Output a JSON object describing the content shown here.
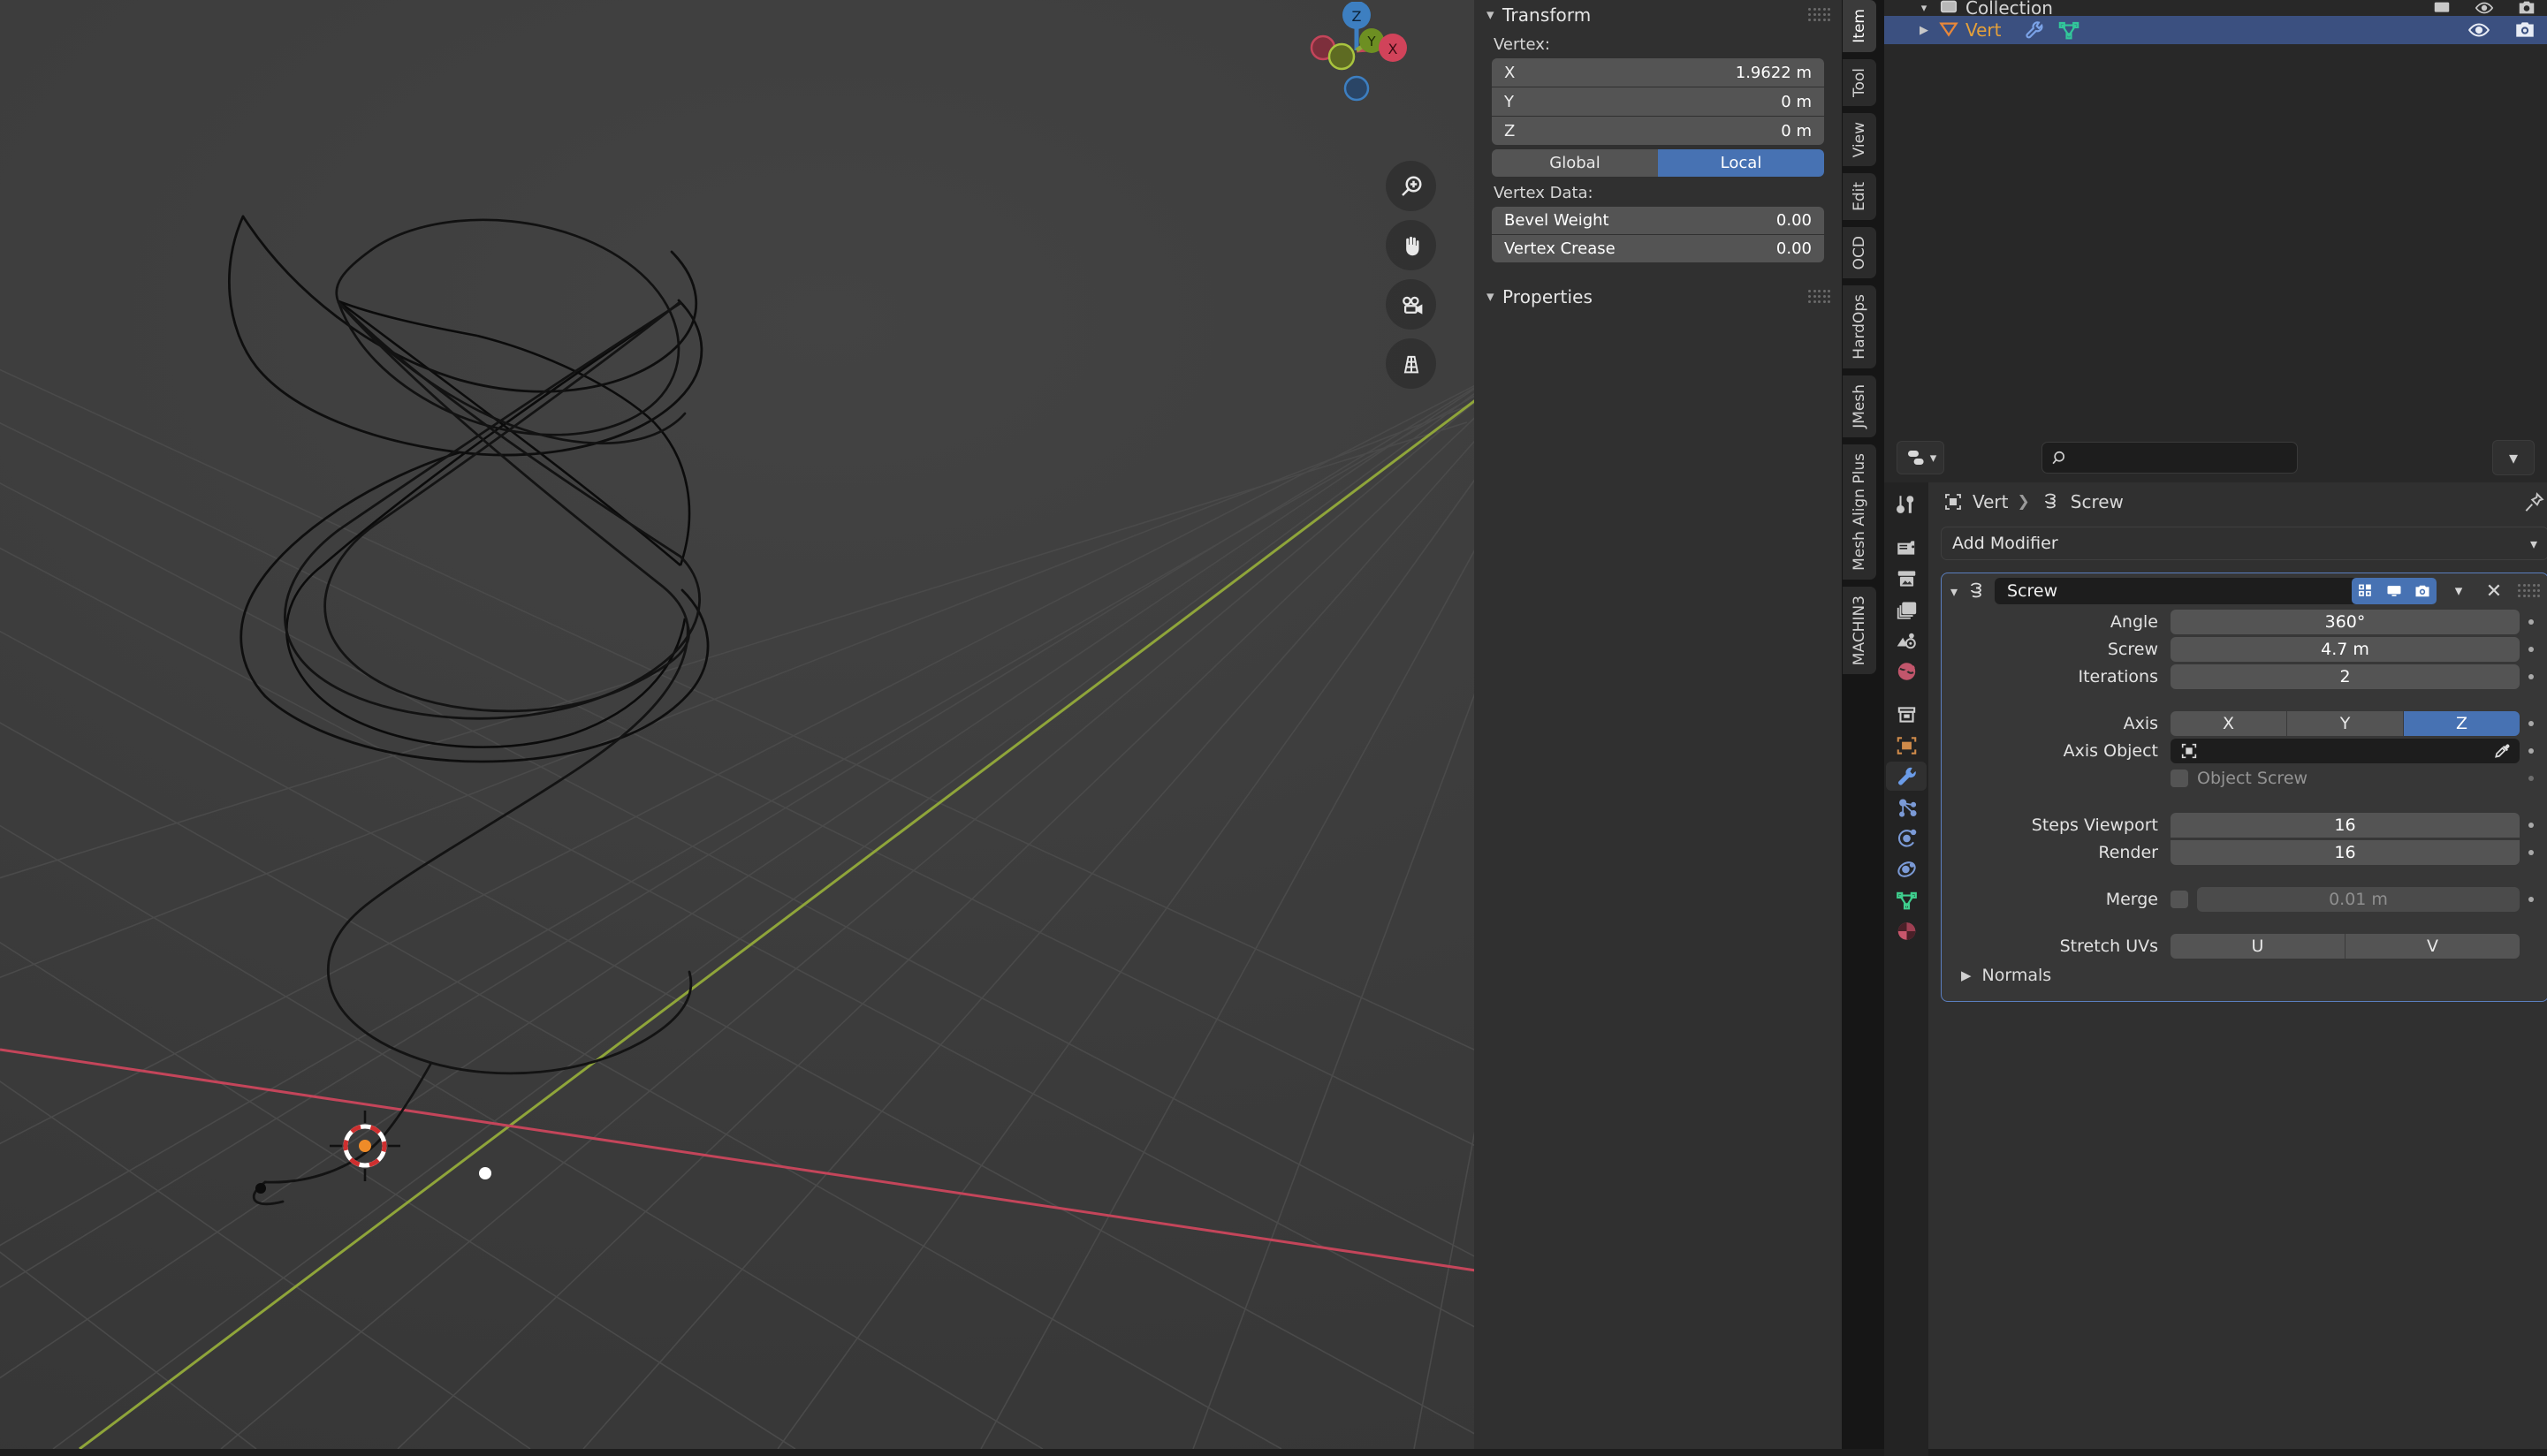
{
  "viewport": {
    "gizmo": {
      "z": "Z",
      "y": "Y",
      "x": "X"
    },
    "nav_buttons": [
      {
        "name": "zoom-icon",
        "label": "Zoom"
      },
      {
        "name": "hand-icon",
        "label": "Move View"
      },
      {
        "name": "camera-icon",
        "label": "Camera View"
      },
      {
        "name": "grid-icon",
        "label": "Toggle Perspective"
      }
    ],
    "axis_colors": {
      "x": "#c4455a",
      "y": "#8fa53a",
      "z": "#3d7fc1"
    },
    "grid_color": "#4b4b4b",
    "cursor_colors": {
      "ring_a": "#ffffff",
      "ring_b": "#cf2f2f",
      "origin": "#ef8b28"
    }
  },
  "sidebar": {
    "transform": {
      "title": "Transform",
      "vertex_label": "Vertex:",
      "fields": [
        {
          "key": "X",
          "value": "1.9622 m"
        },
        {
          "key": "Y",
          "value": "0 m"
        },
        {
          "key": "Z",
          "value": "0 m"
        }
      ],
      "space": {
        "options": [
          "Global",
          "Local"
        ],
        "selected": "Local"
      },
      "vertex_data_label": "Vertex Data:",
      "vertex_data": [
        {
          "key": "Bevel Weight",
          "value": "0.00"
        },
        {
          "key": "Vertex Crease",
          "value": "0.00"
        }
      ]
    },
    "properties_section": {
      "title": "Properties"
    },
    "tabs": [
      {
        "label": "Item",
        "active": true
      },
      {
        "label": "Tool",
        "active": false
      },
      {
        "label": "View",
        "active": false
      },
      {
        "label": "Edit",
        "active": false
      },
      {
        "label": "OCD",
        "active": false
      },
      {
        "label": "HardOps",
        "active": false
      },
      {
        "label": "JMesh",
        "active": false
      },
      {
        "label": "Mesh Align Plus",
        "active": false
      },
      {
        "label": "MACHIN3",
        "active": false
      }
    ]
  },
  "outliner": {
    "collection_row": {
      "label": "Collection"
    },
    "object_row": {
      "label": "Vert",
      "selected": true,
      "highlight_color": "#3b5080",
      "name_color": "#e5a13a",
      "icons": [
        "mesh-object-icon",
        "wrench-modifier-icon",
        "mesh-data-icon"
      ],
      "right_icons": [
        "eye-icon",
        "camera-icon"
      ]
    }
  },
  "properties": {
    "header": {
      "editor_type_label": "Editor Type",
      "search_placeholder": "",
      "search_value": ""
    },
    "nav_tabs": [
      {
        "name": "tool-tab",
        "color": "#c8c8c8",
        "active": false
      },
      {
        "name": "render-tab",
        "color": "#c8c8c8",
        "active": false
      },
      {
        "name": "output-tab",
        "color": "#c8c8c8",
        "active": false
      },
      {
        "name": "view-layer-tab",
        "color": "#c8c8c8",
        "active": false
      },
      {
        "name": "scene-tab",
        "color": "#c8c8c8",
        "active": false
      },
      {
        "name": "world-tab",
        "color": "#c2566c",
        "active": false
      },
      {
        "name": "collection-tab",
        "color": "#c8c8c8",
        "active": false
      },
      {
        "name": "object-tab",
        "color": "#d08b4a",
        "active": false
      },
      {
        "name": "modifier-tab",
        "color": "#6b9ce8",
        "active": true
      },
      {
        "name": "particles-tab",
        "color": "#7b9ad6",
        "active": false
      },
      {
        "name": "physics-tab",
        "color": "#7b9ad6",
        "active": false
      },
      {
        "name": "constraints-tab",
        "color": "#7b9ad6",
        "active": false
      },
      {
        "name": "data-tab",
        "color": "#3fcf8e",
        "active": false
      },
      {
        "name": "material-tab",
        "color": "#c9566c",
        "active": false
      }
    ],
    "breadcrumb": {
      "object": "Vert",
      "modifier": "Screw"
    },
    "add_modifier_label": "Add Modifier",
    "modifier": {
      "name": "Screw",
      "header_toggles": [
        {
          "name": "edit-mode-toggle",
          "on": true
        },
        {
          "name": "realtime-display-toggle",
          "on": true
        },
        {
          "name": "render-toggle",
          "on": true
        }
      ],
      "extras_label": "",
      "close_label": "✕",
      "rows": [
        {
          "label": "Angle",
          "value": "360°",
          "type": "number"
        },
        {
          "label": "Screw",
          "value": "4.7 m",
          "type": "number"
        },
        {
          "label": "Iterations",
          "value": "2",
          "type": "number"
        }
      ],
      "axis": {
        "label": "Axis",
        "options": [
          "X",
          "Y",
          "Z"
        ],
        "selected": "Z"
      },
      "axis_object": {
        "label": "Axis Object",
        "value": ""
      },
      "object_screw": {
        "label": "Object Screw",
        "checked": false,
        "enabled": false
      },
      "steps": [
        {
          "label": "Steps Viewport",
          "value": "16"
        },
        {
          "label": "Render",
          "value": "16"
        }
      ],
      "merge": {
        "label": "Merge",
        "checked": false,
        "value": "0.01 m"
      },
      "stretch_uvs": {
        "label": "Stretch UVs",
        "options": [
          "U",
          "V"
        ],
        "selected": null
      },
      "normals_label": "Normals"
    },
    "accent_color": "#4772b3",
    "panel_outline_color": "#5b7fc0"
  }
}
